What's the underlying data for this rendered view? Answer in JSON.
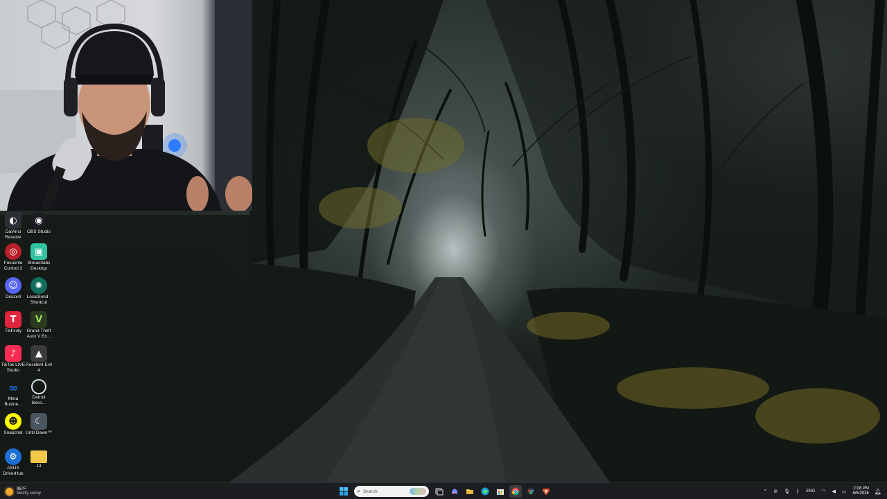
{
  "desktop": {
    "icons": [
      {
        "label": "DaVinci Resolve",
        "icon": "davinci-resolve-icon",
        "color": "#2d2f36"
      },
      {
        "label": "OBS Studio",
        "icon": "obs-studio-icon",
        "color": "#1c1c24"
      },
      {
        "label": "Focusrite Control 2",
        "icon": "focusrite-icon",
        "color": "#b8202a"
      },
      {
        "label": "Streamlabs Desktop",
        "icon": "streamlabs-icon",
        "color": "#31c3a2"
      },
      {
        "label": "Discord",
        "icon": "discord-icon",
        "color": "#5865f2"
      },
      {
        "label": "LocalSend - Shortcut",
        "icon": "localsend-icon",
        "color": "#0f6e5e"
      },
      {
        "label": "TikFinity",
        "icon": "tikfinity-icon",
        "color": "#e0243c"
      },
      {
        "label": "Grand Theft Auto V En...",
        "icon": "gta-icon",
        "color": "#2a3a20"
      },
      {
        "label": "TikTok LIVE Studio",
        "icon": "tiktok-live-icon",
        "color": "#fe2c55"
      },
      {
        "label": "Resident Evil 4",
        "icon": "resident-evil-icon",
        "color": "#3a3a3a"
      },
      {
        "label": "Meta Busine...",
        "icon": "meta-icon",
        "color": "#1877f2"
      },
      {
        "label": "Detroit Beco...",
        "icon": "detroit-icon",
        "color": "#1a4f8a"
      },
      {
        "label": "Snapchat",
        "icon": "snapchat-icon",
        "color": "#fffc00"
      },
      {
        "label": "Until Dawn™",
        "icon": "until-dawn-icon",
        "color": "#4b5560"
      },
      {
        "label": "ASUS DriverHub",
        "icon": "asus-driverhub-icon",
        "color": "#1d6fd6"
      },
      {
        "label": "13",
        "icon": "folder-icon",
        "color": "#f2c84b"
      }
    ]
  },
  "taskbar": {
    "weather": {
      "temp": "95°F",
      "condition": "Mostly sunny",
      "icon": "sun-icon"
    },
    "search": {
      "placeholder": "Search"
    },
    "apps": [
      {
        "name": "start",
        "icon": "windows-start-icon"
      },
      {
        "name": "task-view",
        "icon": "task-view-icon"
      },
      {
        "name": "copilot",
        "icon": "copilot-icon"
      },
      {
        "name": "file-explorer",
        "icon": "file-explorer-icon"
      },
      {
        "name": "edge",
        "icon": "edge-icon"
      },
      {
        "name": "microsoft-store",
        "icon": "store-icon"
      },
      {
        "name": "chrome",
        "icon": "chrome-icon",
        "active": true
      },
      {
        "name": "davinci-resolve",
        "icon": "davinci-taskbar-icon"
      },
      {
        "name": "brave",
        "icon": "brave-icon"
      }
    ],
    "tray": {
      "language": "ENG",
      "time": "2:08 PM",
      "date": "8/5/2026"
    }
  }
}
